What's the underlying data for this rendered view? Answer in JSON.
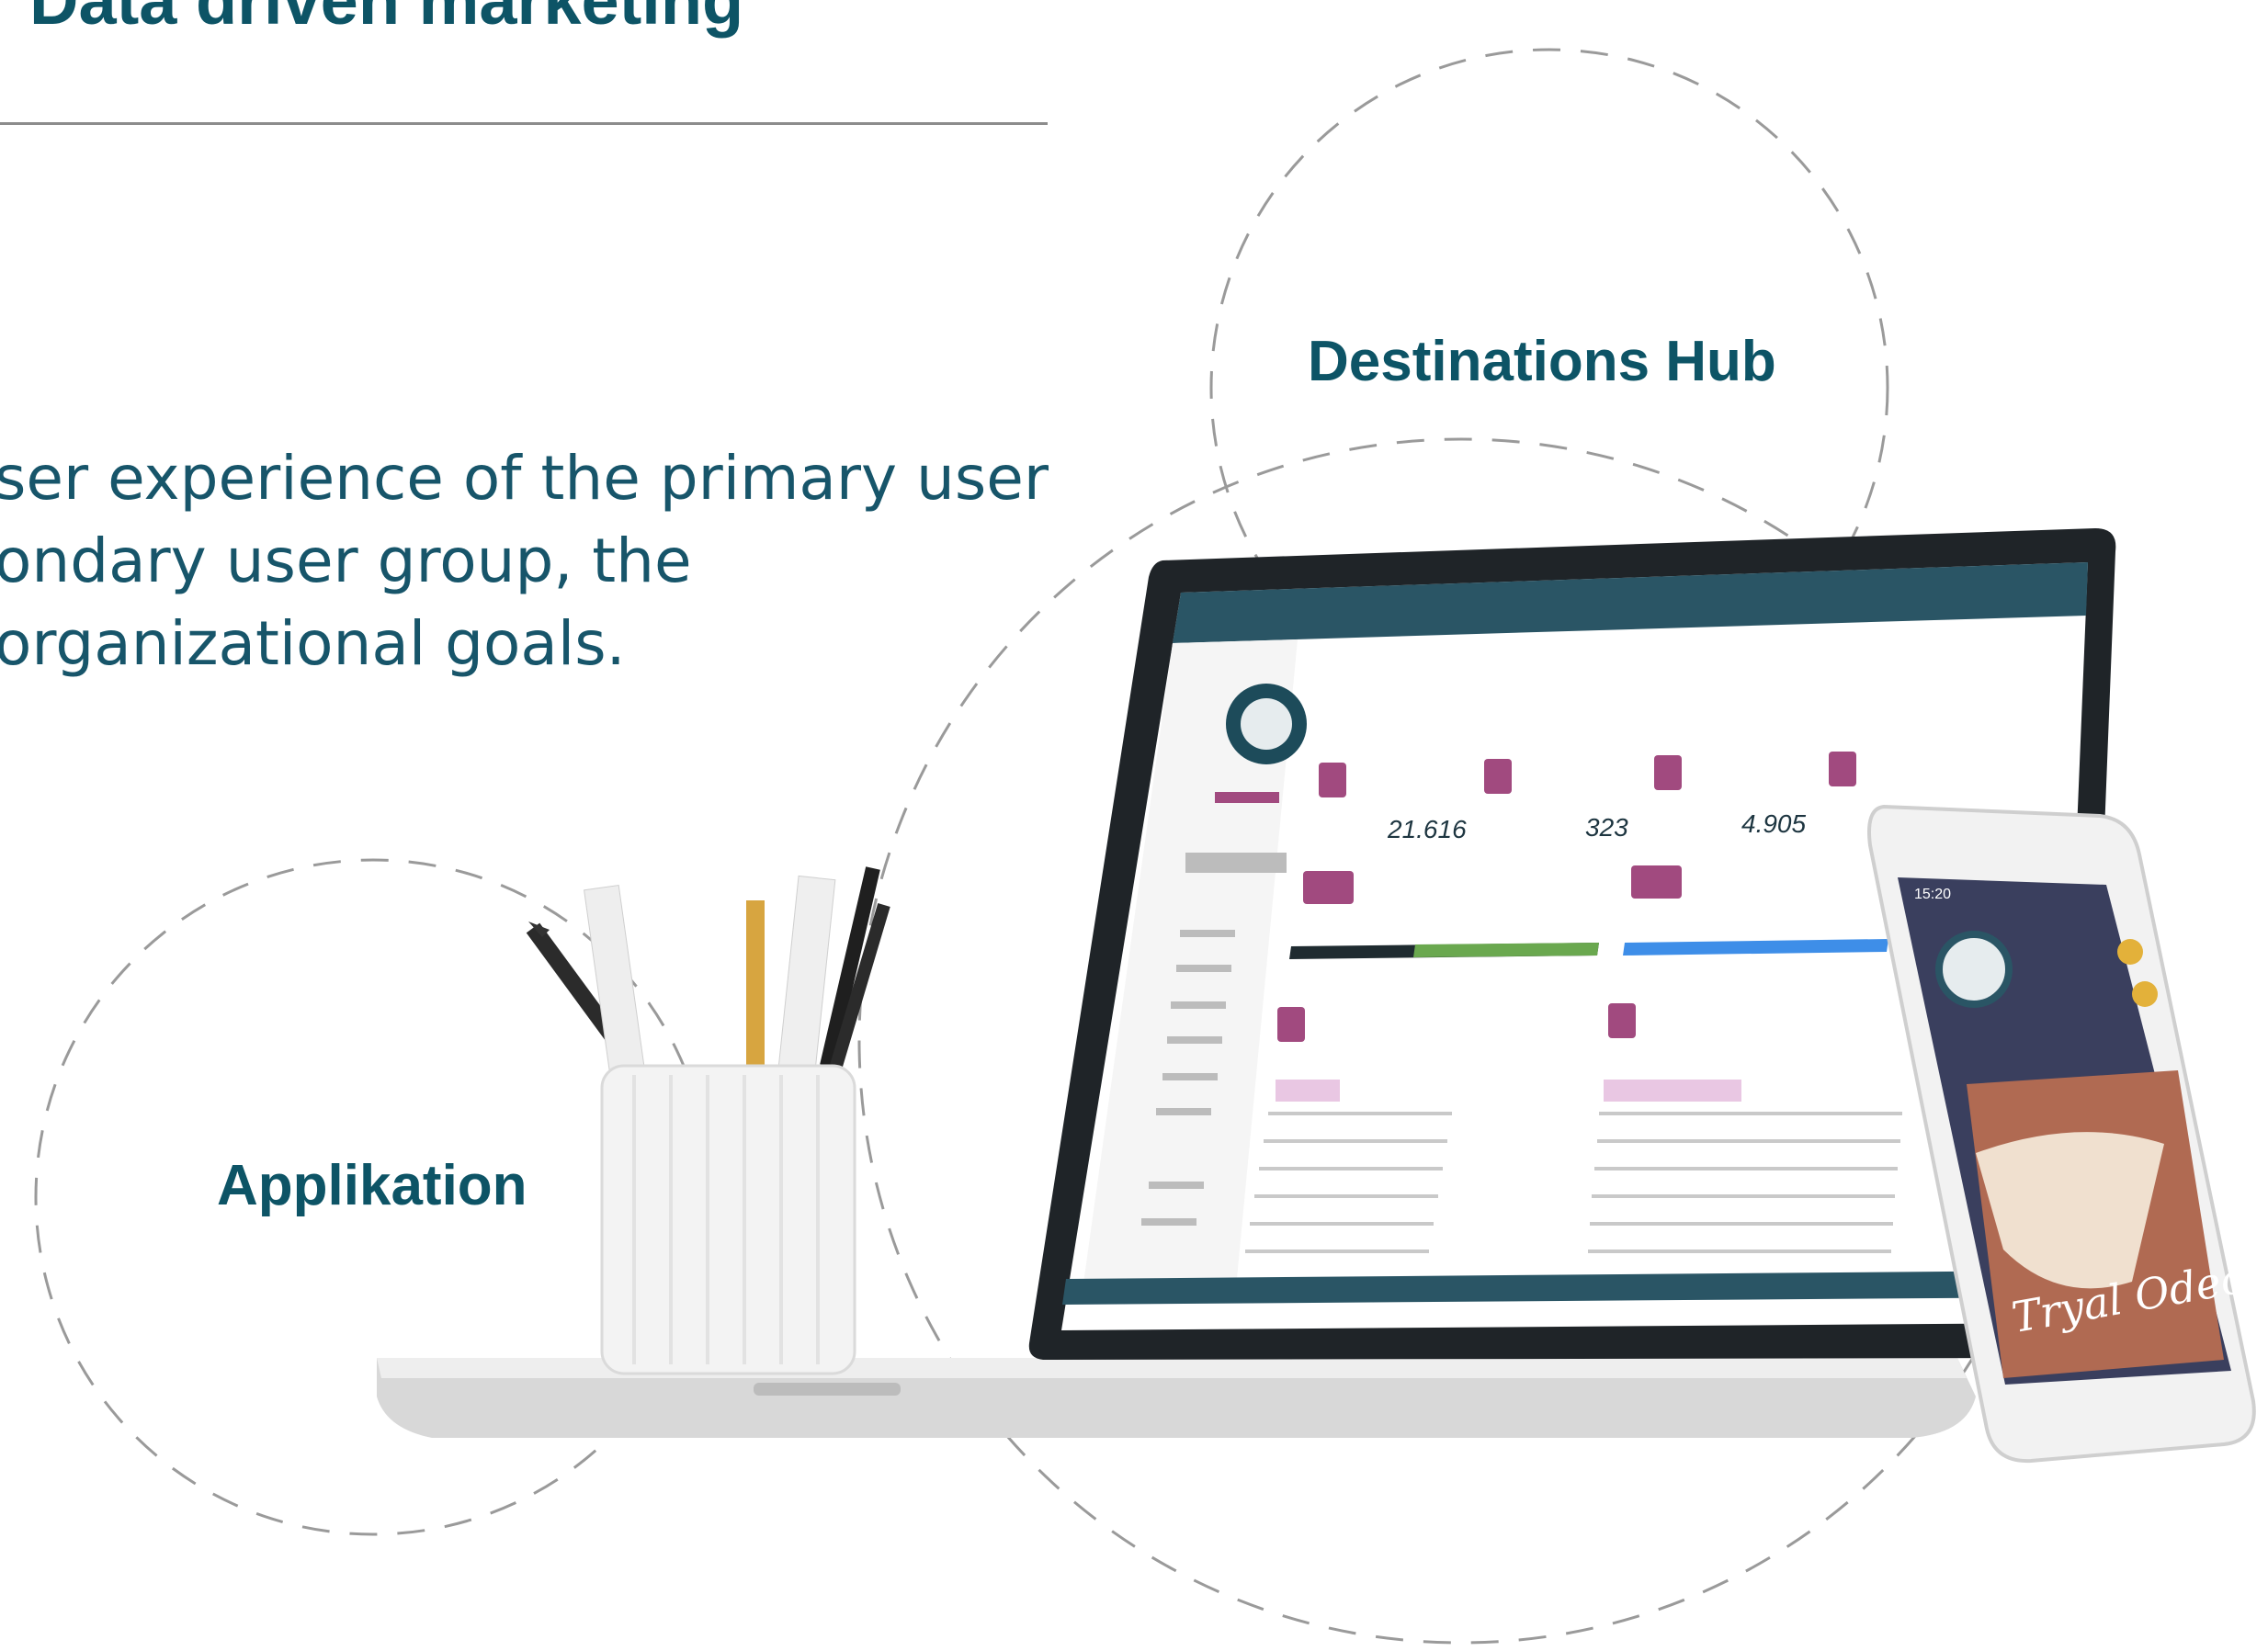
{
  "header": {
    "title": "Data driven marketing"
  },
  "intro": {
    "lines": [
      "ser experience of the primary user",
      "ondary user group, the",
      "organizational goals."
    ]
  },
  "captions": {
    "destinations": "Destinations Hub",
    "app": "Applikation"
  },
  "laptop_screen": {
    "stats": [
      "21.616",
      "323",
      "4.905"
    ]
  },
  "phone_screen": {
    "script_title": "Tryal Odeon",
    "time": "15:20"
  },
  "colors": {
    "brand": "#0d5466",
    "accent": "#a14a7f",
    "bar_green": "#6aa84f",
    "bar_blue": "#3e8ee8"
  }
}
